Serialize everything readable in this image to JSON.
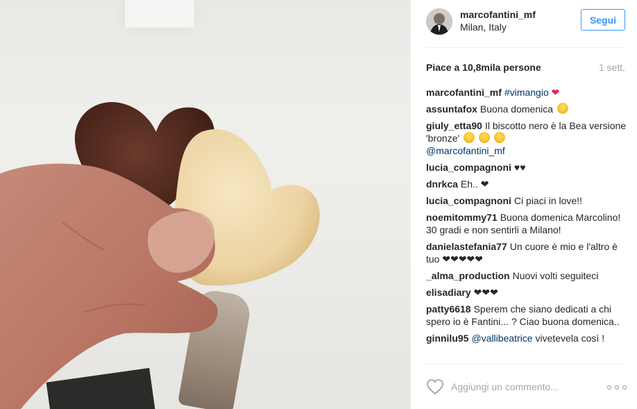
{
  "post": {
    "username": "marcofantini_mf",
    "location": "Milan, Italy",
    "follow_label": "Segui",
    "likes_text": "Piace a 10,8mila persone",
    "date": "1 sett."
  },
  "caption": {
    "user": "marcofantini_mf",
    "hashtag": "#vimangio",
    "emoji": "❤️"
  },
  "comments": [
    {
      "user": "assuntafox",
      "text": "Buona domenica",
      "emoji": "smile"
    },
    {
      "user": "giuly_etta90",
      "text": "Il biscotto nero è la Bea versione 'bronze'",
      "emoji": "grin glasses glasses",
      "mention": "@marcofantini_mf"
    },
    {
      "user": "lucia_compagnoni",
      "text": "♥♥"
    },
    {
      "user": "dnrkca",
      "text": "Eh.. ❤"
    },
    {
      "user": "lucia_compagnoni",
      "text": "Ci piaci in love!!"
    },
    {
      "user": "noemitommy71",
      "text": "Buona domenica Marcolino! 30 gradi e non sentirli a Milano!"
    },
    {
      "user": "danielastefania77",
      "text": "Un cuore è mio e l'altro è tuo ❤❤❤❤❤"
    },
    {
      "user": "_alma_production",
      "text": "Nuovi volti seguiteci"
    },
    {
      "user": "elisadiary",
      "text": "❤❤❤"
    },
    {
      "user": "patty6618",
      "text": "Sperem che siano dedicati a chi spero io è Fantini... ? Ciao buona domenica.."
    },
    {
      "user": "ginnilu95",
      "mention": "@vallibeatrice",
      "text": "vivetevela così !"
    }
  ],
  "footer": {
    "comment_placeholder": "Aggiungi un commento..."
  },
  "icons": {
    "like": "heart-outline-icon",
    "more": "more-options-icon"
  },
  "colors": {
    "accent": "#3897f0",
    "link": "#003569",
    "text": "#262626",
    "muted": "#a5a7aa"
  }
}
